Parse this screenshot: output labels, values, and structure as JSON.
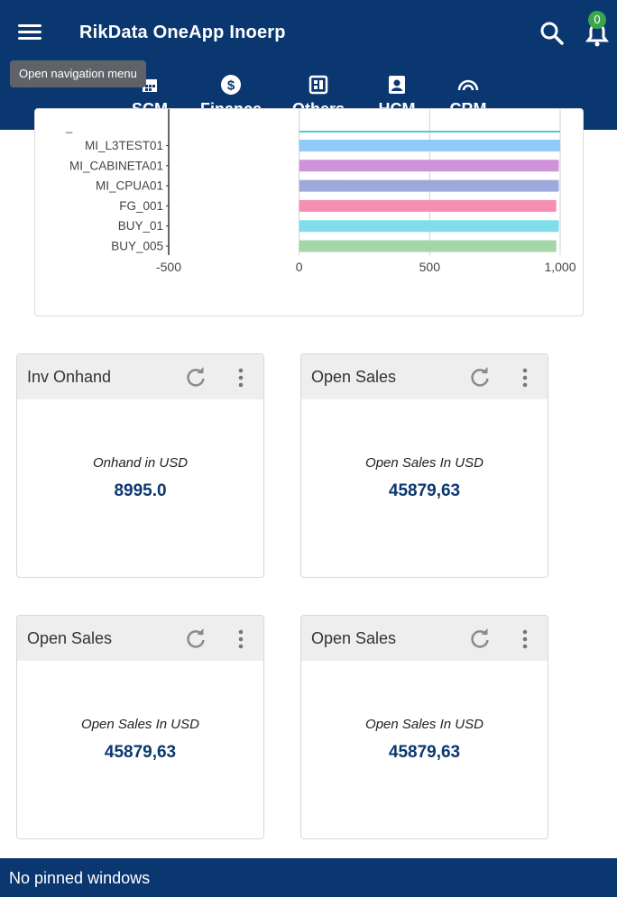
{
  "header": {
    "title": "RikData OneApp Inoerp",
    "notification_count": "0",
    "menu_tooltip": "Open navigation menu"
  },
  "tabs": [
    {
      "label": "SCM",
      "icon": "warehouse-icon",
      "active": true
    },
    {
      "label": "Finance",
      "icon": "dollar-icon",
      "active": false
    },
    {
      "label": "Others",
      "icon": "dashboard-icon",
      "active": false
    },
    {
      "label": "HCM",
      "icon": "person-badge-icon",
      "active": false
    },
    {
      "label": "CRM",
      "icon": "rainbow-icon",
      "active": false
    }
  ],
  "chart_data": {
    "type": "bar",
    "orientation": "horizontal",
    "categories": [
      "MI_L3TEST01",
      "MI_CABINETA01",
      "MI_CPUA01",
      "FG_001",
      "BUY_01",
      "BUY_005"
    ],
    "values": [
      1000,
      995,
      995,
      985,
      995,
      985
    ],
    "colors": [
      "#90caf9",
      "#ce93d8",
      "#9fa8da",
      "#f48fb1",
      "#80deea",
      "#a5d6a7"
    ],
    "x_ticks": [
      "-500",
      "0",
      "500",
      "1,000"
    ],
    "xlim": [
      -500,
      1000
    ],
    "grid": true
  },
  "widgets": [
    {
      "title": "Inv Onhand",
      "subtitle": "Onhand in USD",
      "value": "8995.0"
    },
    {
      "title": "Open Sales",
      "subtitle": "Open Sales In USD",
      "value": "45879,63"
    },
    {
      "title": "Open Sales",
      "subtitle": "Open Sales In USD",
      "value": "45879,63"
    },
    {
      "title": "Open Sales",
      "subtitle": "Open Sales In USD",
      "value": "45879,63"
    }
  ],
  "footer": {
    "text": "No pinned windows"
  },
  "colors": {
    "primary": "#0b3770",
    "badge": "#3aa64a",
    "widget_header": "#eeeeee"
  }
}
